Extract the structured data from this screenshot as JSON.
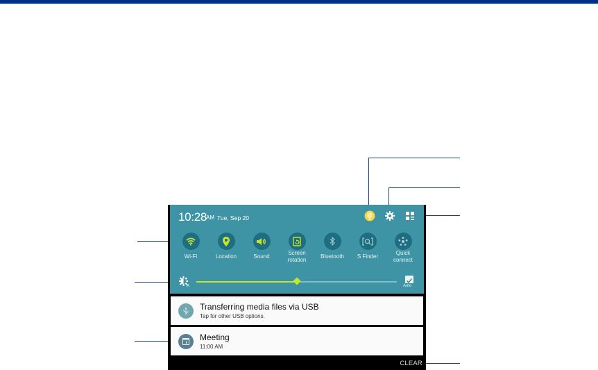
{
  "status": {
    "time": "10:28",
    "ampm": "AM",
    "date": "Tue, Sep 20"
  },
  "header_icons": [
    {
      "name": "user-profile-icon",
      "color": "#f2d848"
    },
    {
      "name": "settings-gear-icon",
      "color": "#ffffff"
    },
    {
      "name": "quick-settings-grid-icon",
      "color": "#ffffff"
    }
  ],
  "quick_settings": [
    {
      "label": "Wi-Fi",
      "icon": "wifi-icon",
      "active": true
    },
    {
      "label": "Location",
      "icon": "location-pin-icon",
      "active": true
    },
    {
      "label": "Sound",
      "icon": "sound-speaker-icon",
      "active": true
    },
    {
      "label": "Screen rotation",
      "icon": "screen-rotation-icon",
      "active": true
    },
    {
      "label": "Bluetooth",
      "icon": "bluetooth-icon",
      "active": false
    },
    {
      "label": "S Finder",
      "icon": "s-finder-icon",
      "active": false
    },
    {
      "label": "Quick connect",
      "icon": "quick-connect-icon",
      "active": false
    }
  ],
  "brightness": {
    "level_percent": 50,
    "auto_label": "Auto",
    "auto_checked": true
  },
  "notifications": [
    {
      "title": "Transferring media files via USB",
      "subtitle": "Tap for other USB options.",
      "icon": "usb-icon",
      "icon_color": "#6fa7ad"
    },
    {
      "title": "Meeting",
      "subtitle": "11:00 AM",
      "icon": "calendar-icon",
      "icon_color": "#5b7f93"
    }
  ],
  "clear_label": "CLEAR",
  "colors": {
    "accent_active": "#c7e52c",
    "panel_bg": "#3e94a4",
    "tile_bg": "#1f6d80",
    "top_bar": "#003087",
    "callout_line": "#1c3f7a"
  }
}
